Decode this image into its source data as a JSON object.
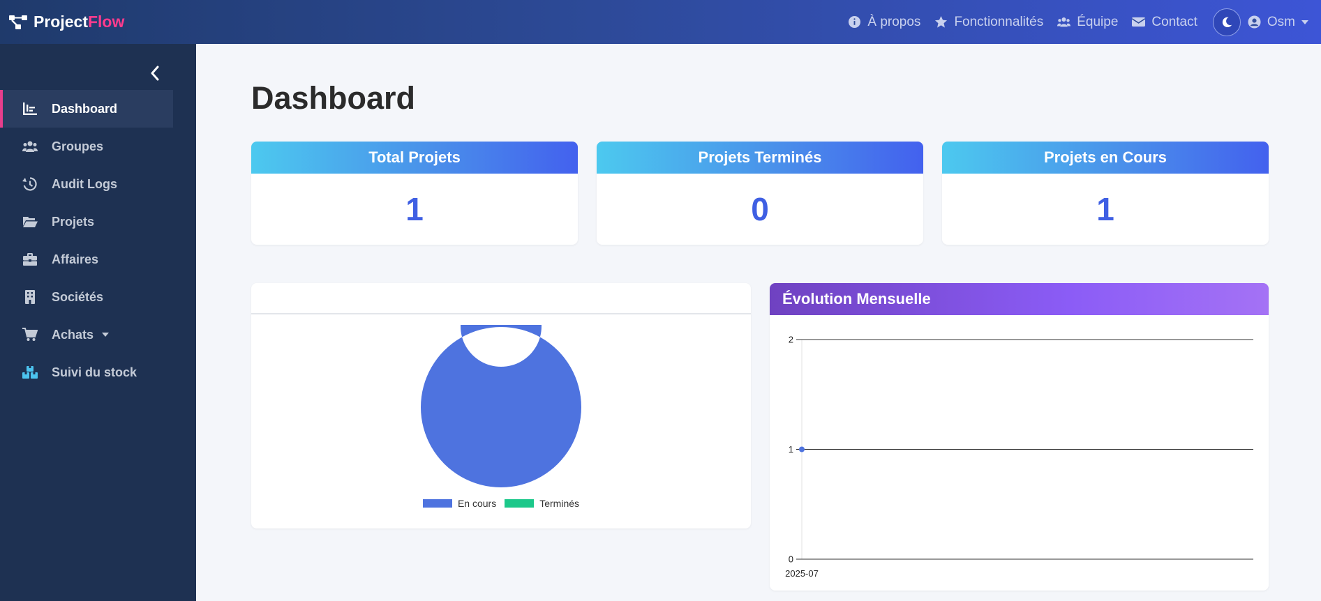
{
  "brand": {
    "name_main": "Project",
    "name_accent": "Flow"
  },
  "nav": {
    "links": [
      {
        "label": "À propos",
        "icon": "info-circle-icon"
      },
      {
        "label": "Fonctionnalités",
        "icon": "star-icon"
      },
      {
        "label": "Équipe",
        "icon": "users-icon"
      },
      {
        "label": "Contact",
        "icon": "envelope-icon"
      }
    ],
    "theme_toggle_icon": "moon-icon",
    "user": {
      "name": "Osm",
      "icon": "user-circle-icon"
    }
  },
  "sidebar": {
    "collapse_icon": "chevron-left-icon",
    "items": [
      {
        "label": "Dashboard",
        "icon": "chart-icon",
        "active": true
      },
      {
        "label": "Groupes",
        "icon": "users-icon"
      },
      {
        "label": "Audit Logs",
        "icon": "history-icon"
      },
      {
        "label": "Projets",
        "icon": "folder-open-icon"
      },
      {
        "label": "Affaires",
        "icon": "briefcase-icon"
      },
      {
        "label": "Sociétés",
        "icon": "building-icon"
      },
      {
        "label": "Achats",
        "icon": "cart-icon",
        "dropdown": true
      },
      {
        "label": "Suivi du stock",
        "icon": "boxes-icon"
      }
    ]
  },
  "page": {
    "title": "Dashboard"
  },
  "stats": [
    {
      "label": "Total Projets",
      "value": "1"
    },
    {
      "label": "Projets Terminés",
      "value": "0"
    },
    {
      "label": "Projets en Cours",
      "value": "1"
    }
  ],
  "charts": {
    "pie_title": "",
    "line_title": "Évolution Mensuelle"
  },
  "colors": {
    "en_cours": "#4e73df",
    "termines": "#1cc88a",
    "accent_pink": "#ff3b8d",
    "stat_value": "#3f5fe3"
  },
  "chart_data": [
    {
      "type": "pie",
      "title": "",
      "categories": [
        "En cours",
        "Terminés"
      ],
      "values": [
        1,
        0
      ],
      "legend": "bottom"
    },
    {
      "type": "line",
      "title": "Évolution Mensuelle",
      "x": [
        "2025-07"
      ],
      "series": [
        {
          "values": [
            1
          ]
        }
      ],
      "ylim": [
        0,
        2
      ],
      "yticks": [
        0,
        1,
        2
      ],
      "grid": true
    }
  ]
}
